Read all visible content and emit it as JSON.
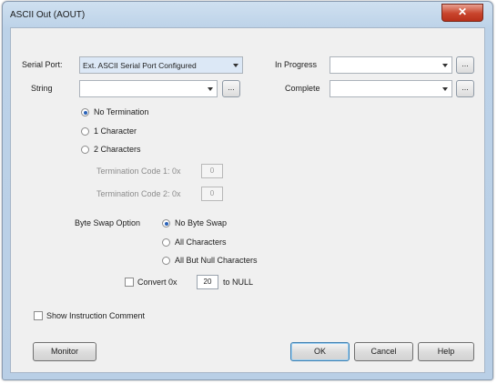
{
  "window": {
    "title": "ASCII Out (AOUT)",
    "close_glyph": "✕"
  },
  "fields": {
    "serial_port": {
      "label": "Serial Port:",
      "value": "Ext. ASCII Serial Port Configured"
    },
    "string": {
      "label": "String",
      "value": ""
    },
    "in_progress": {
      "label": "In Progress",
      "value": ""
    },
    "complete": {
      "label": "Complete",
      "value": ""
    },
    "browse_glyph": "..."
  },
  "termination": {
    "options": [
      "No Termination",
      "1 Character",
      "2 Characters"
    ],
    "selected": "No Termination",
    "code1_label": "Termination Code 1:  0x",
    "code1_value": "0",
    "code2_label": "Termination Code 2:  0x",
    "code2_value": "0"
  },
  "byte_swap": {
    "label": "Byte Swap Option",
    "options": [
      "No Byte Swap",
      "All Characters",
      "All But Null Characters"
    ],
    "selected": "No Byte Swap"
  },
  "convert": {
    "label": "Convert 0x",
    "value": "20",
    "suffix": "to NULL",
    "checked": false
  },
  "show_comment": {
    "label": "Show Instruction Comment",
    "checked": false
  },
  "buttons": {
    "monitor": "Monitor",
    "ok": "OK",
    "cancel": "Cancel",
    "help": "Help"
  }
}
